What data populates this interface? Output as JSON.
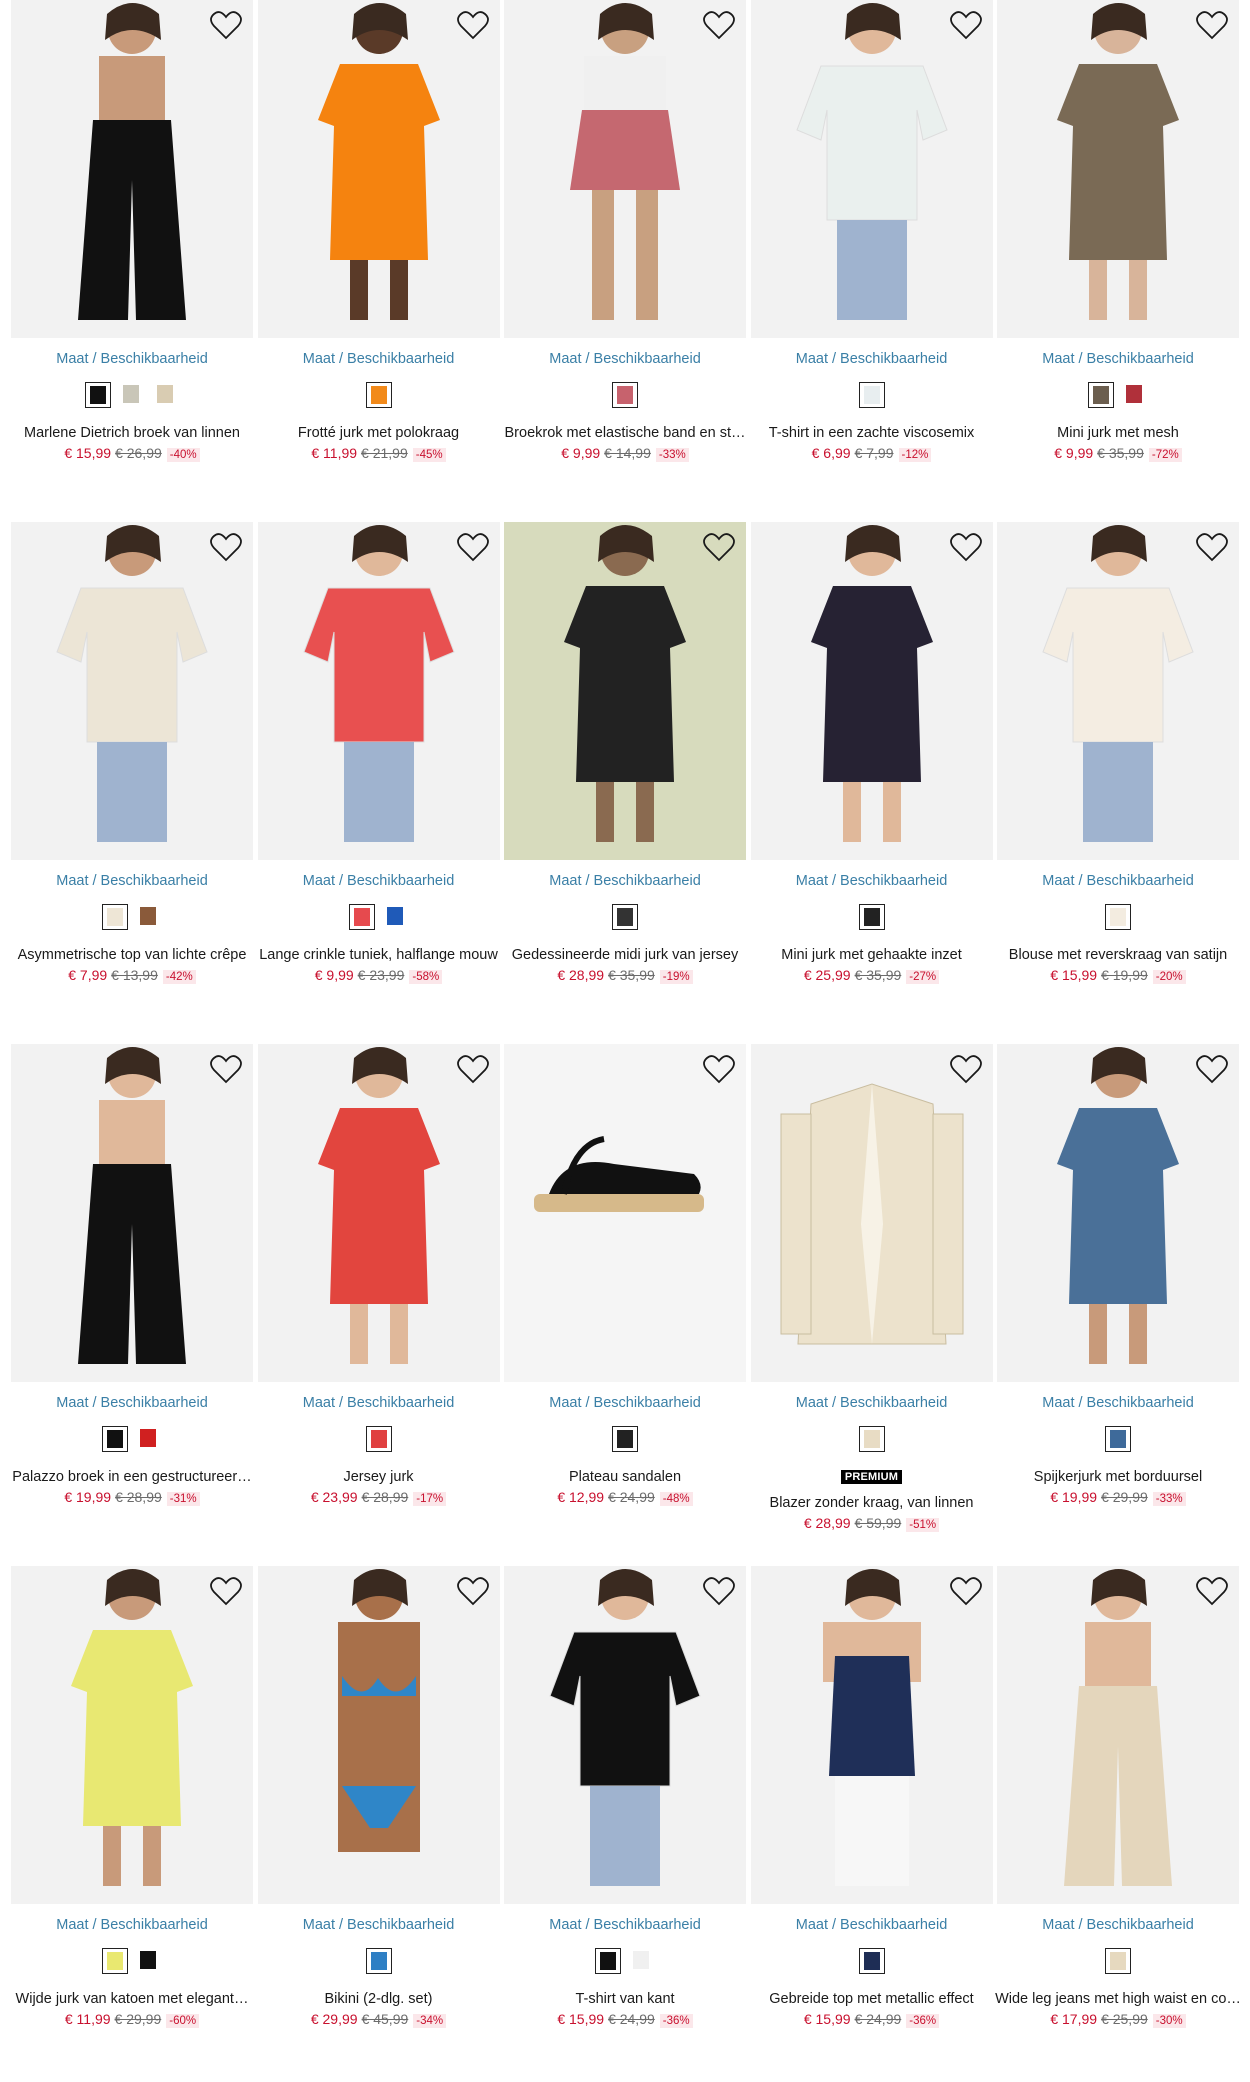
{
  "size_link_label": "Maat / Beschikbaarheid",
  "premium_badge": "PREMIUM",
  "colors": {
    "price": "#c8102e",
    "link": "#3a7fa6",
    "discount_bg": "#fbe7ea"
  },
  "products": [
    {
      "title": "Marlene Dietrich broek van linnen",
      "price": "€ 15,99",
      "old": "€ 26,99",
      "disc": "-40%",
      "swatches": [
        "#111111",
        "#c9c6b8",
        "#d9ccb2"
      ],
      "premium": false,
      "img": {
        "bg": "#f2f2f2",
        "garment": "#111111",
        "skin": "#c89a7a",
        "kind": "pants"
      }
    },
    {
      "title": "Frotté jurk met polokraag",
      "price": "€ 11,99",
      "old": "€ 21,99",
      "disc": "-45%",
      "swatches": [
        "#f28a1a"
      ],
      "premium": false,
      "img": {
        "bg": "#f2f2f2",
        "garment": "#f5830f",
        "skin": "#5a3a28",
        "kind": "dress"
      }
    },
    {
      "title": "Broekrok met elastische band en st…",
      "price": "€ 9,99",
      "old": "€ 14,99",
      "disc": "-33%",
      "swatches": [
        "#c7626d"
      ],
      "premium": false,
      "img": {
        "bg": "#f2f2f2",
        "garment": "#c56870",
        "skin": "#c8a080",
        "kind": "skirt"
      }
    },
    {
      "title": "T-shirt in een zachte viscosemix",
      "price": "€ 6,99",
      "old": "€ 7,99",
      "disc": "-12%",
      "swatches": [
        "#e8eef0"
      ],
      "premium": false,
      "img": {
        "bg": "#f2f2f2",
        "garment": "#eaf0ee",
        "skin": "#e0b89a",
        "kind": "tee"
      }
    },
    {
      "title": "Mini jurk met mesh",
      "price": "€ 9,99",
      "old": "€ 35,99",
      "disc": "-72%",
      "swatches": [
        "#6b5e4e",
        "#b0303a"
      ],
      "premium": false,
      "img": {
        "bg": "#f2f2f2",
        "garment": "#7a6a55",
        "skin": "#d8b49a",
        "kind": "dress"
      }
    },
    {
      "title": "Asymmetrische top van lichte crêpe",
      "price": "€ 7,99",
      "old": "€ 13,99",
      "disc": "-42%",
      "swatches": [
        "#eee6d6",
        "#8a5a3a"
      ],
      "premium": false,
      "img": {
        "bg": "#f2f2f2",
        "garment": "#ece5d6",
        "skin": "#c89a7a",
        "kind": "tee"
      }
    },
    {
      "title": "Lange crinkle tuniek, halflange mouw",
      "price": "€ 9,99",
      "old": "€ 23,99",
      "disc": "-58%",
      "swatches": [
        "#e64a4e",
        "#1f5ab8"
      ],
      "premium": false,
      "img": {
        "bg": "#f2f2f2",
        "garment": "#e85050",
        "skin": "#e0b89a",
        "kind": "tee"
      }
    },
    {
      "title": "Gedessineerde midi jurk van jersey",
      "price": "€ 28,99",
      "old": "€ 35,99",
      "disc": "-19%",
      "swatches": [
        "#333333"
      ],
      "premium": false,
      "img": {
        "bg": "#d7dbbd",
        "garment": "#222222",
        "skin": "#8a6a50",
        "kind": "dress"
      }
    },
    {
      "title": "Mini jurk met gehaakte inzet",
      "price": "€ 25,99",
      "old": "€ 35,99",
      "disc": "-27%",
      "swatches": [
        "#222222"
      ],
      "premium": false,
      "img": {
        "bg": "#f2f2f2",
        "garment": "#262233",
        "skin": "#e0b89a",
        "kind": "dress"
      }
    },
    {
      "title": "Blouse met reverskraag van satijn",
      "price": "€ 15,99",
      "old": "€ 19,99",
      "disc": "-20%",
      "swatches": [
        "#f3ece0"
      ],
      "premium": false,
      "img": {
        "bg": "#f2f2f2",
        "garment": "#f4ede2",
        "skin": "#e0b89a",
        "kind": "tee"
      }
    },
    {
      "title": "Palazzo broek in een gestructureer…",
      "price": "€ 19,99",
      "old": "€ 28,99",
      "disc": "-31%",
      "swatches": [
        "#111111",
        "#d02020"
      ],
      "premium": false,
      "img": {
        "bg": "#f2f2f2",
        "garment": "#111111",
        "skin": "#e0b89a",
        "kind": "pants"
      }
    },
    {
      "title": "Jersey jurk",
      "price": "€ 23,99",
      "old": "€ 28,99",
      "disc": "-17%",
      "swatches": [
        "#e04040"
      ],
      "premium": false,
      "img": {
        "bg": "#f2f2f2",
        "garment": "#e2453e",
        "skin": "#e0b89a",
        "kind": "dress"
      }
    },
    {
      "title": "Plateau sandalen",
      "price": "€ 12,99",
      "old": "€ 24,99",
      "disc": "-48%",
      "swatches": [
        "#222222"
      ],
      "premium": false,
      "img": {
        "bg": "#f5f5f5",
        "garment": "#111111",
        "skin": "#d6b98a",
        "kind": "shoe"
      }
    },
    {
      "title": "Blazer zonder kraag, van linnen",
      "price": "€ 28,99",
      "old": "€ 59,99",
      "disc": "-51%",
      "swatches": [
        "#e8dcc4"
      ],
      "premium": true,
      "img": {
        "bg": "#f2f2f2",
        "garment": "#ece2cc",
        "skin": "#e0b89a",
        "kind": "blazer"
      }
    },
    {
      "title": "Spijkerjurk met borduursel",
      "price": "€ 19,99",
      "old": "€ 29,99",
      "disc": "-33%",
      "swatches": [
        "#3e6a9a"
      ],
      "premium": false,
      "img": {
        "bg": "#f2f2f2",
        "garment": "#4a7098",
        "skin": "#c89a7a",
        "kind": "dress"
      }
    },
    {
      "title": "Wijde jurk van katoen met elegant…",
      "price": "€ 11,99",
      "old": "€ 29,99",
      "disc": "-60%",
      "swatches": [
        "#e9e870",
        "#111111"
      ],
      "premium": false,
      "img": {
        "bg": "#f2f2f2",
        "garment": "#e8e872",
        "skin": "#c89a7a",
        "kind": "dress"
      }
    },
    {
      "title": "Bikini (2-dlg. set)",
      "price": "€ 29,99",
      "old": "€ 45,99",
      "disc": "-34%",
      "swatches": [
        "#2e7fc4"
      ],
      "premium": false,
      "img": {
        "bg": "#f2f2f2",
        "garment": "#2f86c8",
        "skin": "#a8704a",
        "kind": "bikini"
      }
    },
    {
      "title": "T-shirt van kant",
      "price": "€ 15,99",
      "old": "€ 24,99",
      "disc": "-36%",
      "swatches": [
        "#111111",
        "#f0f0f0"
      ],
      "premium": false,
      "img": {
        "bg": "#f2f2f2",
        "garment": "#111111",
        "skin": "#e0b89a",
        "kind": "tee"
      }
    },
    {
      "title": "Gebreide top met metallic effect",
      "price": "€ 15,99",
      "old": "€ 24,99",
      "disc": "-36%",
      "swatches": [
        "#1e2d55"
      ],
      "premium": false,
      "img": {
        "bg": "#f2f2f2",
        "garment": "#1f2f58",
        "skin": "#e0b89a",
        "kind": "tank"
      }
    },
    {
      "title": "Wide leg jeans met high waist en co…",
      "price": "€ 17,99",
      "old": "€ 25,99",
      "disc": "-30%",
      "swatches": [
        "#e6d9bf"
      ],
      "premium": false,
      "img": {
        "bg": "#f2f2f2",
        "garment": "#e4d6bc",
        "skin": "#e0b89a",
        "kind": "pants"
      }
    }
  ]
}
